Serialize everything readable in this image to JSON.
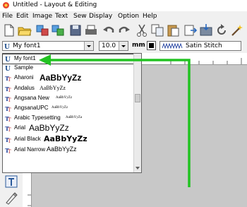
{
  "window": {
    "title": "Untitled - Layout & Editing"
  },
  "menu": [
    "File",
    "Edit",
    "Image",
    "Text",
    "Sew",
    "Display",
    "Option",
    "Help"
  ],
  "toolbar": {
    "font_select": {
      "value": "My font1"
    },
    "size_select": {
      "value": "10.0"
    },
    "unit_label": "mm",
    "stitch_select": {
      "value": "Satin Stitch"
    }
  },
  "font_list": {
    "items": [
      {
        "name": "My font1",
        "preview": "",
        "icon": "user-font-icon",
        "selected": true
      },
      {
        "name": "Sample",
        "preview": "",
        "icon": "user-font-icon"
      },
      {
        "name": "Aharoni",
        "preview": "AaBbYyZz",
        "icon": "truetype-icon",
        "style": "bold-large"
      },
      {
        "name": "Andalus",
        "preview": "AaBbYyZz",
        "icon": "truetype-icon",
        "style": "serif-small"
      },
      {
        "name": "Angsana New",
        "preview": "AaBbYyZz",
        "icon": "truetype-icon",
        "style": "serif-tiny"
      },
      {
        "name": "AngsanaUPC",
        "preview": "AaBbYyZz",
        "icon": "truetype-icon",
        "style": "serif-tiny"
      },
      {
        "name": "Arabic Typesetting",
        "preview": "AaBbYyZa",
        "icon": "truetype-icon",
        "style": "serif-tiny"
      },
      {
        "name": "Arial",
        "preview": "AaBbYyZz",
        "icon": "truetype-icon",
        "style": "sans-large"
      },
      {
        "name": "Arial Black",
        "preview": "AaBbYyZz",
        "icon": "truetype-icon",
        "style": "black-large"
      },
      {
        "name": "Arial Narrow",
        "preview": "AaBbYyZz",
        "icon": "truetype-icon",
        "style": "sans-medium"
      }
    ]
  },
  "annotation_color": "#22c322"
}
